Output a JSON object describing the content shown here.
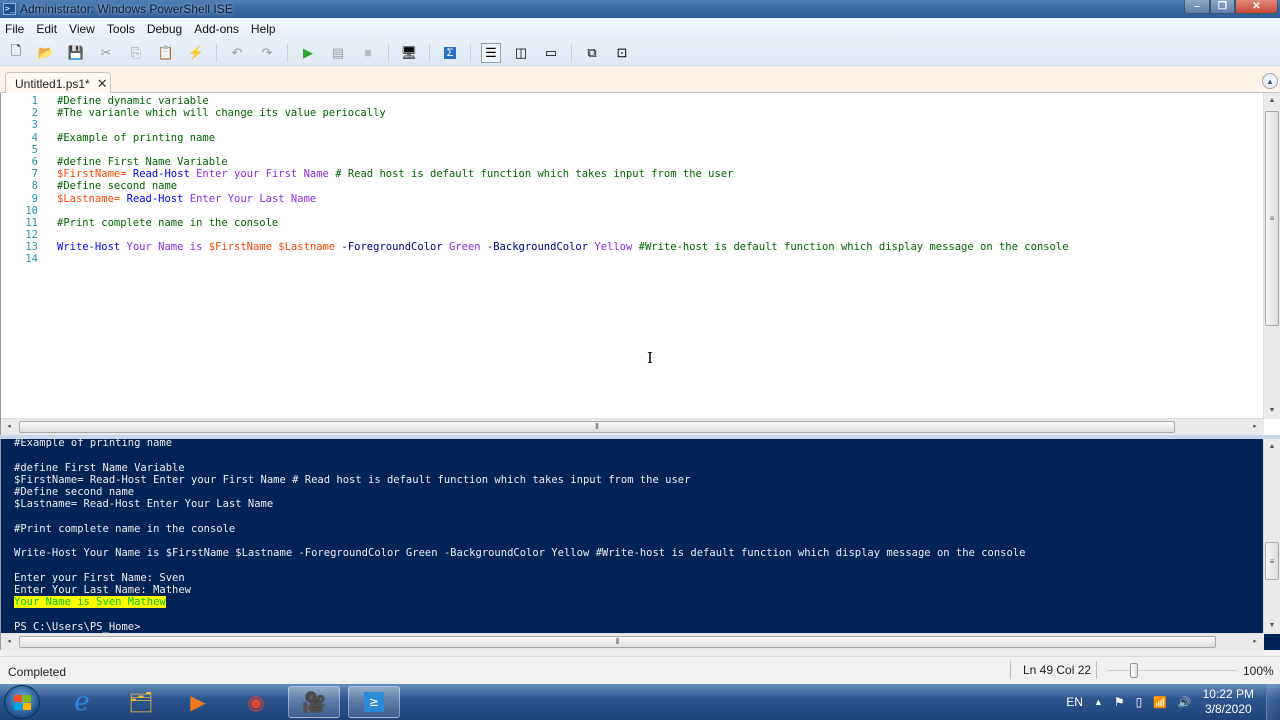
{
  "window": {
    "title": "Administrator: Windows PowerShell ISE",
    "controls": {
      "minimize": "–",
      "maximize": "❐",
      "close": "✕"
    }
  },
  "menu": [
    "File",
    "Edit",
    "View",
    "Tools",
    "Debug",
    "Add-ons",
    "Help"
  ],
  "toolbar": {
    "buttons": [
      {
        "name": "new-script",
        "icon": "new-file-icon",
        "glyph": "🗋",
        "enabled": true
      },
      {
        "name": "open-script",
        "icon": "folder-open-icon",
        "glyph": "📂",
        "enabled": true
      },
      {
        "name": "save-script",
        "icon": "save-icon",
        "glyph": "💾",
        "enabled": true
      },
      {
        "name": "cut",
        "icon": "scissors-icon",
        "glyph": "✂",
        "enabled": false
      },
      {
        "name": "copy",
        "icon": "copy-icon",
        "glyph": "⎘",
        "enabled": false
      },
      {
        "name": "paste",
        "icon": "clipboard-icon",
        "glyph": "📋",
        "enabled": true
      },
      {
        "name": "clear-console",
        "icon": "clear-console-icon",
        "glyph": "⚡",
        "enabled": true
      },
      {
        "name": "undo",
        "icon": "undo-icon",
        "glyph": "↶",
        "enabled": false
      },
      {
        "name": "redo",
        "icon": "redo-icon",
        "glyph": "↷",
        "enabled": false
      },
      {
        "name": "run-script",
        "icon": "play-icon",
        "glyph": "▶",
        "enabled": true
      },
      {
        "name": "run-selection",
        "icon": "run-selection-icon",
        "glyph": "▤",
        "enabled": false
      },
      {
        "name": "stop",
        "icon": "stop-icon",
        "glyph": "■",
        "enabled": false
      },
      {
        "name": "new-remote-tab",
        "icon": "remote-computer-icon",
        "glyph": "🖥",
        "enabled": true
      },
      {
        "name": "start-powershell",
        "icon": "powershell-icon",
        "glyph": "Σ",
        "enabled": true
      },
      {
        "name": "show-script-top",
        "icon": "layout-top-icon",
        "glyph": "☰",
        "enabled": true,
        "selected": true
      },
      {
        "name": "show-script-right",
        "icon": "layout-right-icon",
        "glyph": "◫",
        "enabled": true
      },
      {
        "name": "show-script-maximized",
        "icon": "layout-max-icon",
        "glyph": "▭",
        "enabled": true
      },
      {
        "name": "show-command-window",
        "icon": "command-window-icon",
        "glyph": "⧉",
        "enabled": true
      },
      {
        "name": "show-command-addon",
        "icon": "command-addon-icon",
        "glyph": "⊡",
        "enabled": true
      }
    ]
  },
  "tabs": [
    {
      "label": "Untitled1.ps1*",
      "close": "✕",
      "active": true
    }
  ],
  "editor": {
    "line_numbers": [
      "1",
      "2",
      "3",
      "4",
      "5",
      "6",
      "7",
      "8",
      "9",
      "10",
      "11",
      "12",
      "13",
      "14"
    ],
    "lines": [
      [
        {
          "t": "#Define dynamic variable",
          "c": "com"
        }
      ],
      [
        {
          "t": "#The varianle which will change its value periocally",
          "c": "com"
        }
      ],
      [],
      [
        {
          "t": "#Example of printing name",
          "c": "com"
        }
      ],
      [],
      [
        {
          "t": "#define First Name Variable",
          "c": "com"
        }
      ],
      [
        {
          "t": "$FirstName",
          "c": "var"
        },
        {
          "t": "= ",
          "c": "var"
        },
        {
          "t": "Read-Host",
          "c": "cmd"
        },
        {
          "t": " Enter your First Name ",
          "c": "str"
        },
        {
          "t": "# Read host is default function which takes input from the user",
          "c": "com"
        }
      ],
      [
        {
          "t": "#Define second name",
          "c": "com"
        }
      ],
      [
        {
          "t": "$Lastname",
          "c": "var"
        },
        {
          "t": "= ",
          "c": "var"
        },
        {
          "t": "Read-Host",
          "c": "cmd"
        },
        {
          "t": " Enter Your Last Name",
          "c": "str"
        }
      ],
      [],
      [
        {
          "t": "#Print complete name in the console",
          "c": "com"
        }
      ],
      [],
      [
        {
          "t": "Write-Host",
          "c": "cmd"
        },
        {
          "t": " Your Name is ",
          "c": "str"
        },
        {
          "t": "$FirstName",
          "c": "var"
        },
        {
          "t": " ",
          "c": "str"
        },
        {
          "t": "$Lastname",
          "c": "var"
        },
        {
          "t": " -ForegroundColor",
          "c": "par"
        },
        {
          "t": " Green",
          "c": "str"
        },
        {
          "t": " -BackgroundColor",
          "c": "par"
        },
        {
          "t": " Yellow",
          "c": "str"
        },
        {
          "t": " #Write-host is default function which display message on the console",
          "c": "com"
        }
      ],
      []
    ]
  },
  "console": {
    "lines": [
      {
        "t": "#Example of printing name"
      },
      {
        "t": ""
      },
      {
        "t": "#define First Name Variable"
      },
      {
        "t": "$FirstName= Read-Host Enter your First Name # Read host is default function which takes input from the user"
      },
      {
        "t": "#Define second name"
      },
      {
        "t": "$Lastname= Read-Host Enter Your Last Name"
      },
      {
        "t": ""
      },
      {
        "t": "#Print complete name in the console"
      },
      {
        "t": ""
      },
      {
        "t": "Write-Host Your Name is $FirstName $Lastname -ForegroundColor Green -BackgroundColor Yellow #Write-host is default function which display message on the console"
      },
      {
        "t": ""
      },
      {
        "t": "Enter your First Name: Sven"
      },
      {
        "t": "Enter Your Last Name: Mathew"
      },
      {
        "t": "Your Name is Sven Mathew",
        "highlight": true
      },
      {
        "t": ""
      },
      {
        "t": "PS C:\\Users\\PS_Home>"
      }
    ]
  },
  "statusbar": {
    "status": "Completed",
    "position": "Ln 49  Col 22",
    "zoom": "100%",
    "zoom_slider_fraction": 0.2
  },
  "taskbar": {
    "apps": [
      {
        "name": "internet-explorer",
        "icon": "internet-explorer-icon",
        "glyph": "e",
        "color": "#2a8ae0"
      },
      {
        "name": "file-explorer",
        "icon": "folder-icon",
        "glyph": "🗂",
        "color": "#f0c040"
      },
      {
        "name": "media-player",
        "icon": "media-player-icon",
        "glyph": "▶",
        "color": "#f07a20"
      },
      {
        "name": "chrome",
        "icon": "chrome-icon",
        "glyph": "◉",
        "color": "#dd4433"
      },
      {
        "name": "camtasia",
        "icon": "camera-icon",
        "glyph": "🎥",
        "color": "#dddddd",
        "active": true
      },
      {
        "name": "powershell-ise",
        "icon": "powershell-icon",
        "glyph": "≥",
        "color": "#2a8ad8",
        "active": true
      }
    ],
    "tray": {
      "language": "EN",
      "show_hidden": "▲",
      "flag": "⚑",
      "battery": "▯",
      "signal": "📶",
      "volume": "🔊"
    },
    "clock": {
      "time": "10:22 PM",
      "date": "3/8/2020"
    }
  },
  "colors": {
    "console_bg": "#012456",
    "console_fg": "#eeedf0",
    "comment": "#006400",
    "variable": "#ff4500",
    "command": "#0000ff",
    "string": "#8a2be2",
    "parameter": "#000080",
    "highlight_bg": "#ffff00",
    "highlight_fg": "#00c800"
  }
}
